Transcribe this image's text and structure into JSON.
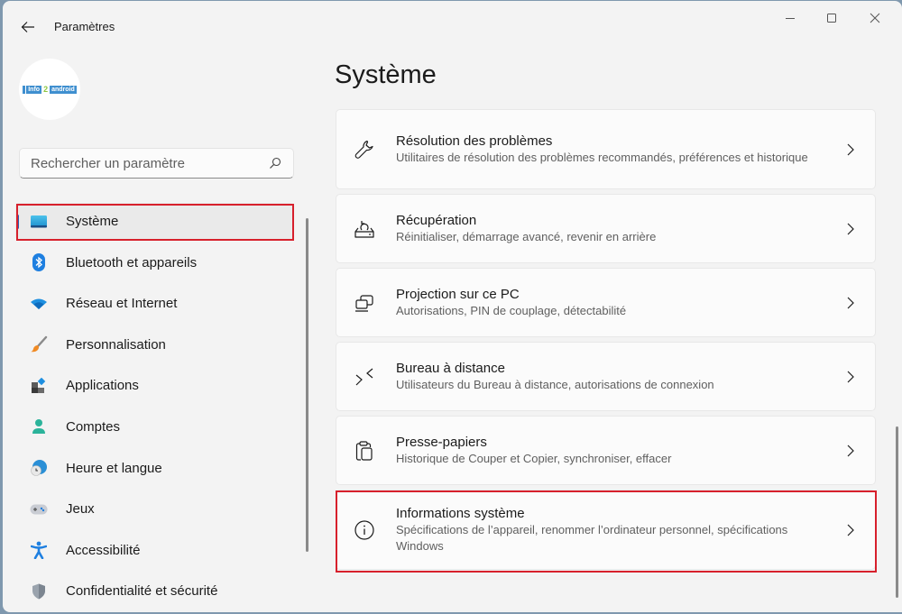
{
  "window": {
    "title": "Paramètres",
    "controls": {
      "minimize": "minimize-icon",
      "maximize": "maximize-icon",
      "close": "close-icon"
    }
  },
  "account": {
    "logo_parts": [
      "Info",
      "2",
      "android"
    ]
  },
  "search": {
    "placeholder": "Rechercher un paramètre",
    "value": ""
  },
  "sidebar": {
    "items": [
      {
        "label": "Système",
        "icon": "system-display-icon",
        "active": true,
        "highlighted": true
      },
      {
        "label": "Bluetooth et appareils",
        "icon": "bluetooth-icon"
      },
      {
        "label": "Réseau et Internet",
        "icon": "wifi-icon"
      },
      {
        "label": "Personnalisation",
        "icon": "paintbrush-icon"
      },
      {
        "label": "Applications",
        "icon": "apps-icon"
      },
      {
        "label": "Comptes",
        "icon": "account-icon"
      },
      {
        "label": "Heure et langue",
        "icon": "time-language-icon"
      },
      {
        "label": "Jeux",
        "icon": "gamepad-icon"
      },
      {
        "label": "Accessibilité",
        "icon": "accessibility-icon"
      },
      {
        "label": "Confidentialité et sécurité",
        "icon": "shield-icon"
      }
    ]
  },
  "main": {
    "title": "Système",
    "cards": [
      {
        "title": "Résolution des problèmes",
        "description": "Utilitaires de résolution des problèmes recommandés, préférences et historique",
        "icon": "wrench-icon"
      },
      {
        "title": "Récupération",
        "description": "Réinitialiser, démarrage avancé, revenir en arrière",
        "icon": "recovery-icon"
      },
      {
        "title": "Projection sur ce PC",
        "description": "Autorisations, PIN de couplage, détectabilité",
        "icon": "projection-icon"
      },
      {
        "title": "Bureau à distance",
        "description": "Utilisateurs du Bureau à distance, autorisations de connexion",
        "icon": "remote-desktop-icon"
      },
      {
        "title": "Presse-papiers",
        "description": "Historique de Couper et Copier, synchroniser, effacer",
        "icon": "clipboard-icon"
      },
      {
        "title": "Informations système",
        "description": "Spécifications de l’appareil, renommer l’ordinateur personnel, spécifications Windows",
        "icon": "info-icon",
        "highlighted": true
      }
    ]
  },
  "colors": {
    "accent": "#2c5fb0",
    "highlight_border": "#d7202c",
    "background": "#f3f3f3",
    "card": "#fbfbfb"
  }
}
